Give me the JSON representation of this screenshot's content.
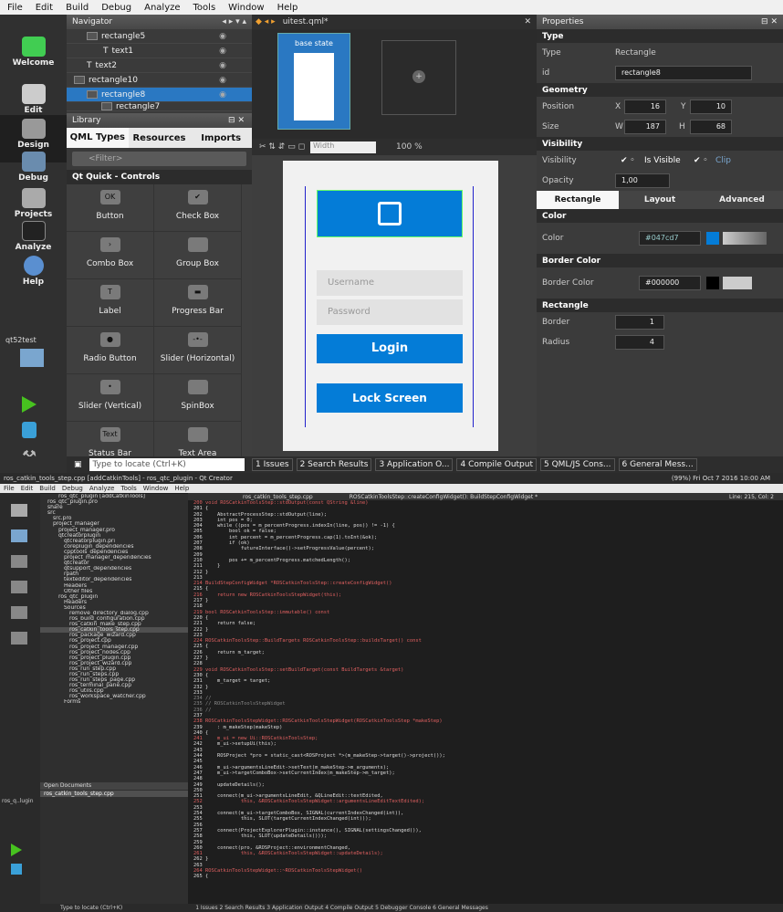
{
  "menu": [
    "File",
    "Edit",
    "Build",
    "Debug",
    "Analyze",
    "Tools",
    "Window",
    "Help"
  ],
  "modes": [
    "Welcome",
    "Edit",
    "Design",
    "Debug",
    "Projects",
    "Analyze",
    "Help"
  ],
  "target": "qt52test",
  "navigator": {
    "title": "Navigator",
    "items": [
      "rectangle5",
      "text1",
      "text2",
      "rectangle10",
      "rectangle8",
      "rectangle7"
    ]
  },
  "doc": {
    "name": "uitest.qml*"
  },
  "states": {
    "base": "base state"
  },
  "library": {
    "title": "Library",
    "tabs": [
      "QML Types",
      "Resources",
      "Imports"
    ],
    "filter": "<Filter>",
    "section": "Qt Quick - Controls",
    "items": [
      {
        "g": "OK",
        "l": "Button"
      },
      {
        "g": "✔",
        "l": "Check Box"
      },
      {
        "g": "›",
        "l": "Combo Box"
      },
      {
        "g": "",
        "l": "Group Box"
      },
      {
        "g": "T",
        "l": "Label"
      },
      {
        "g": "▬",
        "l": "Progress Bar"
      },
      {
        "g": "●",
        "l": "Radio Button"
      },
      {
        "g": "-•-",
        "l": "Slider (Horizontal)"
      },
      {
        "g": "•",
        "l": "Slider (Vertical)"
      },
      {
        "g": "",
        "l": "SpinBox"
      },
      {
        "g": "Text",
        "l": "Status Bar"
      },
      {
        "g": "",
        "l": "Text Area"
      }
    ]
  },
  "canvas": {
    "width_placeholder": "Width",
    "zoom": "100 %",
    "username": "Username",
    "password": "Password",
    "login": "Login",
    "lock": "Lock Screen"
  },
  "properties": {
    "title": "Properties",
    "type_sec": "Type",
    "type_label": "Type",
    "type_val": "Rectangle",
    "id_label": "id",
    "id_val": "rectangle8",
    "geom_sec": "Geometry",
    "pos": "Position",
    "x": "16",
    "y": "10",
    "size": "Size",
    "w": "187",
    "h": "68",
    "vis_sec": "Visibility",
    "vis": "Visibility",
    "isvis": "Is Visible",
    "clip": "Clip",
    "opacity": "Opacity",
    "opval": "1,00",
    "tabs": [
      "Rectangle",
      "Layout",
      "Advanced"
    ],
    "color_sec": "Color",
    "color": "Color",
    "colorval": "#047cd7",
    "bcolor_sec": "Border Color",
    "bcolor": "Border Color",
    "bcolorval": "#000000",
    "rect_sec": "Rectangle",
    "border": "Border",
    "borderval": "1",
    "radius": "Radius",
    "radiusval": "4"
  },
  "locate": "Type to locate (Ctrl+K)",
  "outputs": [
    "1 Issues",
    "2 Search Results",
    "3 Application O...",
    "4 Compile Output",
    "5 QML/JS Cons...",
    "6 General Mess..."
  ],
  "bottom": {
    "title": "ros_catkin_tools_step.cpp [addCatkinTools] - ros_qtc_plugin - Qt Creator",
    "status": "(99%) Fri Oct 7 2016 10:00 AM",
    "menu": [
      "File",
      "Edit",
      "Build",
      "Debug",
      "Analyze",
      "Tools",
      "Window",
      "Help"
    ],
    "file": "ros_catkin_tools_step.cpp",
    "func": "ROSCatkinToolsStep::createConfigWidget(): BuildStepConfigWidget *",
    "line": "Line: 215, Col: 2",
    "tree": [
      "ros_qtc_plugin [addCatkinTools]",
      "ros_qtc_plugin.pro",
      "share",
      "src",
      "src.pro",
      "project_manager",
      "project_manager.pro",
      "qtcreatorplugin",
      "qtcreatorplugin.pri",
      "coreplugin_dependencies",
      "cpptools_dependencies",
      "project_manager_dependencies",
      "qtcreator",
      "qtsupport_dependencies",
      "rpath",
      "texteditor_dependencies",
      "Headers",
      "Other files",
      "ros_qtc_plugin",
      "Headers",
      "Sources",
      "remove_directory_dialog.cpp",
      "ros_build_configuration.cpp",
      "ros_catkin_make_step.cpp",
      "ros_catkin_tools_step.cpp",
      "ros_package_wizard.cpp",
      "ros_project.cpp",
      "ros_project_manager.cpp",
      "ros_project_nodes.cpp",
      "ros_project_plugin.cpp",
      "ros_project_wizard.cpp",
      "ros_run_step.cpp",
      "ros_run_steps.cpp",
      "ros_run_steps_page.cpp",
      "ros_terminal_pane.cpp",
      "ros_utils.cpp",
      "ros_workspace_watcher.cpp",
      "Forms"
    ],
    "open_docs": "Open Documents",
    "open_file": "ros_catkin_tools_step.cpp",
    "code": [
      "200 void ROSCatkinToolsStep::stdOutput(const QString &line)",
      "201 {",
      "202     AbstractProcessStep::stdOutput(line);",
      "203     int pos = 0;",
      "204     while ((pos = m_percentProgress.indexIn(line, pos)) != -1) {",
      "205         bool ok = false;",
      "206         int percent = m_percentProgress.cap(1).toInt(&ok);",
      "207         if (ok)",
      "208             futureInterface()->setProgressValue(percent);",
      "209",
      "210         pos += m_percentProgress.matchedLength();",
      "211     }",
      "212 }",
      "213",
      "214 BuildStepConfigWidget *ROSCatkinToolsStep::createConfigWidget()",
      "215 {",
      "216     return new ROSCatkinToolsStepWidget(this);",
      "217 }",
      "218",
      "219 bool ROSCatkinToolsStep::immutable() const",
      "220 {",
      "221     return false;",
      "222 }",
      "223",
      "224 ROSCatkinToolsStep::BuildTargets ROSCatkinToolsStep::buildsTarget() const",
      "225 {",
      "226     return m_target;",
      "227 }",
      "228",
      "229 void ROSCatkinToolsStep::setBuildTarget(const BuildTargets &target)",
      "230 {",
      "231     m_target = target;",
      "232 }",
      "233",
      "234 //",
      "235 // ROSCatkinToolsStepWidget",
      "236 //",
      "237",
      "238 ROSCatkinToolsStepWidget::ROSCatkinToolsStepWidget(ROSCatkinToolsStep *makeStep)",
      "239     : m_makeStep(makeStep)",
      "240 {",
      "241     m_ui = new Ui::ROSCatkinToolsStep;",
      "242     m_ui->setupUi(this);",
      "243",
      "244     ROSProject *pro = static_cast<ROSProject *>(m_makeStep->target()->project());",
      "245",
      "246     m_ui->argumentsLineEdit->setText(m_makeStep->m_arguments);",
      "247     m_ui->targetComboBox->setCurrentIndex(m_makeStep->m_target);",
      "248",
      "249     updateDetails();",
      "250",
      "251     connect(m_ui->argumentsLineEdit, &QLineEdit::textEdited,",
      "252             this, &ROSCatkinToolsStepWidget::argumentsLineEditTextEdited);",
      "253",
      "254     connect(m_ui->targetComboBox, SIGNAL(currentIndexChanged(int)),",
      "255             this, SLOT(targetCurrentIndexChanged(int)));",
      "256",
      "257     connect(ProjectExplorerPlugin::instance(), SIGNAL(settingsChanged()),",
      "258             this, SLOT(updateDetails()));",
      "259",
      "260     connect(pro, &ROSProject::environmentChanged,",
      "261             this, &ROSCatkinToolsStepWidget::updateDetails);",
      "262 }",
      "263",
      "264 ROSCatkinToolsStepWidget::~ROSCatkinToolsStepWidget()",
      "265 {"
    ],
    "target": "ros_q..lugin",
    "locate": "Type to locate (Ctrl+K)",
    "outputs": "1 Issues  2 Search Results  3 Application Output  4 Compile Output  5 Debugger Console  6 General Messages"
  }
}
